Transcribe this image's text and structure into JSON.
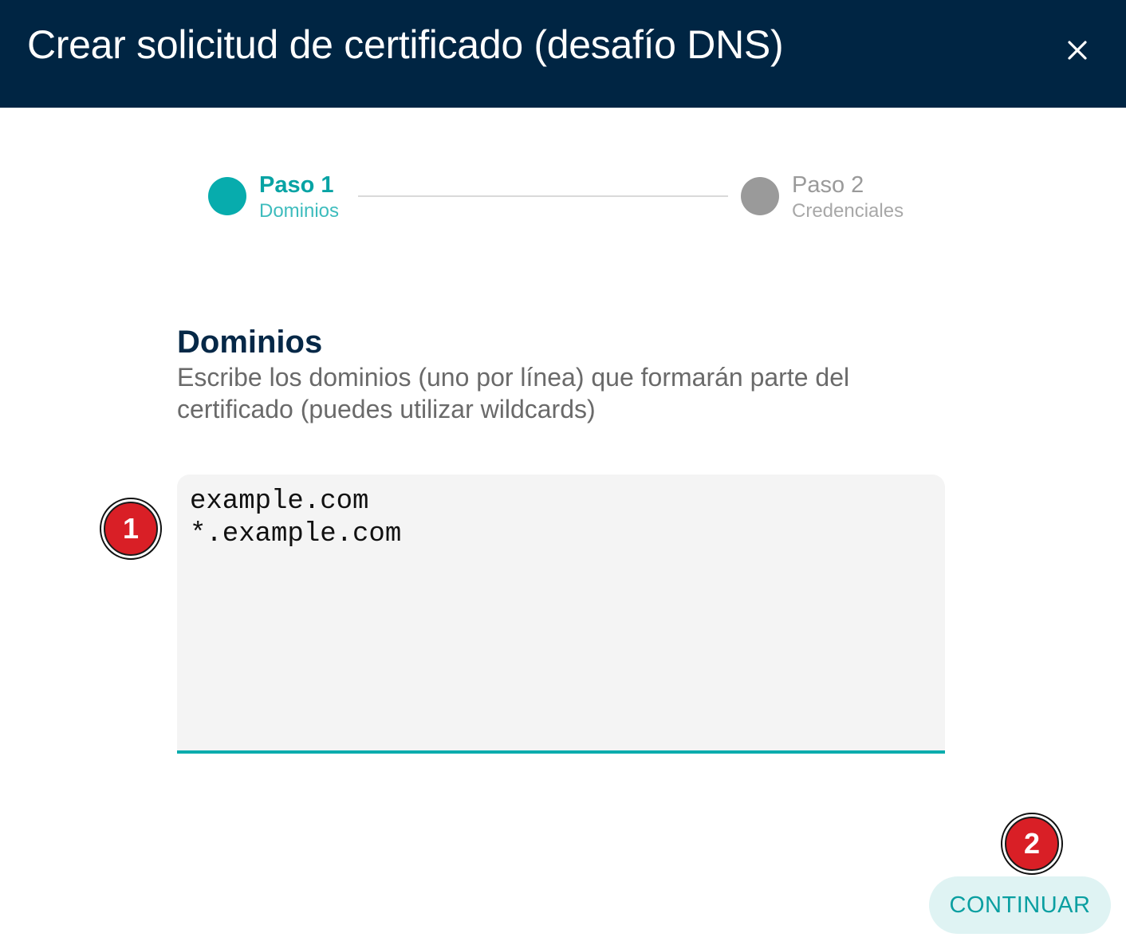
{
  "dialog": {
    "title": "Crear solicitud de certificado (desafío DNS)",
    "close_icon": "close-icon"
  },
  "stepper": {
    "steps": [
      {
        "title": "Paso 1",
        "subtitle": "Dominios",
        "state": "active"
      },
      {
        "title": "Paso 2",
        "subtitle": "Credenciales",
        "state": "inactive"
      }
    ]
  },
  "domains_section": {
    "heading": "Dominios",
    "description": "Escribe los dominios (uno por línea) que formarán parte del certificado (puedes utilizar wildcards)",
    "input_value": "example.com\n*.example.com"
  },
  "annotations": {
    "marker_1": "1",
    "marker_2": "2"
  },
  "actions": {
    "continue_label": "CONTINUAR"
  },
  "colors": {
    "header_bg": "#002543",
    "accent": "#07acad",
    "inactive": "#9a9a9a",
    "marker": "#d91f26"
  }
}
